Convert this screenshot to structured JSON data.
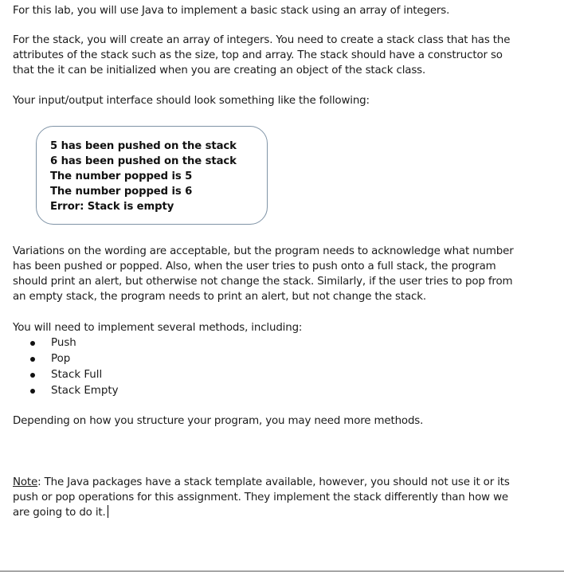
{
  "document": {
    "intro": "For this lab, you will use Java to implement a basic stack using an array of integers.",
    "stack_paragraph": [
      "For the stack, you will create an array of integers. You need to create a stack class that has the",
      "attributes of the stack such as the size, top and array. The stack should have a constructor so",
      "that the it can be initialized when you are creating an object of the stack class."
    ],
    "io_intro": "Your input/output interface should look something like the following:",
    "io_example": [
      "5 has been pushed on the stack",
      "6 has been pushed on the stack",
      "The number popped is 5",
      "The number popped is 6",
      "Error: Stack is empty"
    ],
    "variations_paragraph": [
      "Variations on the wording are acceptable, but the program needs to acknowledge what number",
      "has been pushed or popped. Also, when the user tries to push onto a full stack, the program",
      "should print an alert, but otherwise not change the stack. Similarly, if the user tries to pop from",
      "an empty stack, the program needs to print an alert, but not change the stack."
    ],
    "methods_intro": "You will need to implement several methods, including:",
    "methods": [
      "Push",
      "Pop",
      "Stack Full",
      "Stack Empty"
    ],
    "structure_note": "Depending on how you structure your program, you may need more methods.",
    "note": {
      "label": "Note",
      "lines": [
        ": The Java packages have a stack template available, however, you should not use it or its",
        "push or pop operations for this assignment. They implement the stack differently than how we",
        "are going to do it."
      ]
    }
  }
}
